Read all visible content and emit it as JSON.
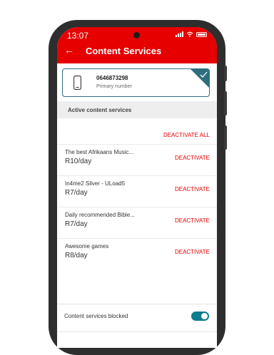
{
  "status_bar": {
    "time": "13:07"
  },
  "header": {
    "title": "Content Services",
    "back_icon": "back-arrow-icon"
  },
  "number_card": {
    "number": "0646873298",
    "label": "Primary number",
    "icon": "phone-icon",
    "selected": true
  },
  "section": {
    "title": "Active content services"
  },
  "deactivate_all_label": "DEACTIVATE ALL",
  "services": [
    {
      "name": "The best Afrikaans Music...",
      "price": "R10/day",
      "action": "DEACTIVATE"
    },
    {
      "name": "In4me2 Silver - ULoad5",
      "price": "R7/day",
      "action": "DEACTIVATE"
    },
    {
      "name": "Daily recommended Bible...",
      "price": "R7/day",
      "action": "DEACTIVATE"
    },
    {
      "name": "Awesome games",
      "price": "R8/day",
      "action": "DEACTIVATE"
    }
  ],
  "blocked": {
    "label": "Content services blocked",
    "enabled": true
  },
  "colors": {
    "brand": "#e60000",
    "accent": "#0d7c8c",
    "card_border": "#2f6e7e"
  }
}
